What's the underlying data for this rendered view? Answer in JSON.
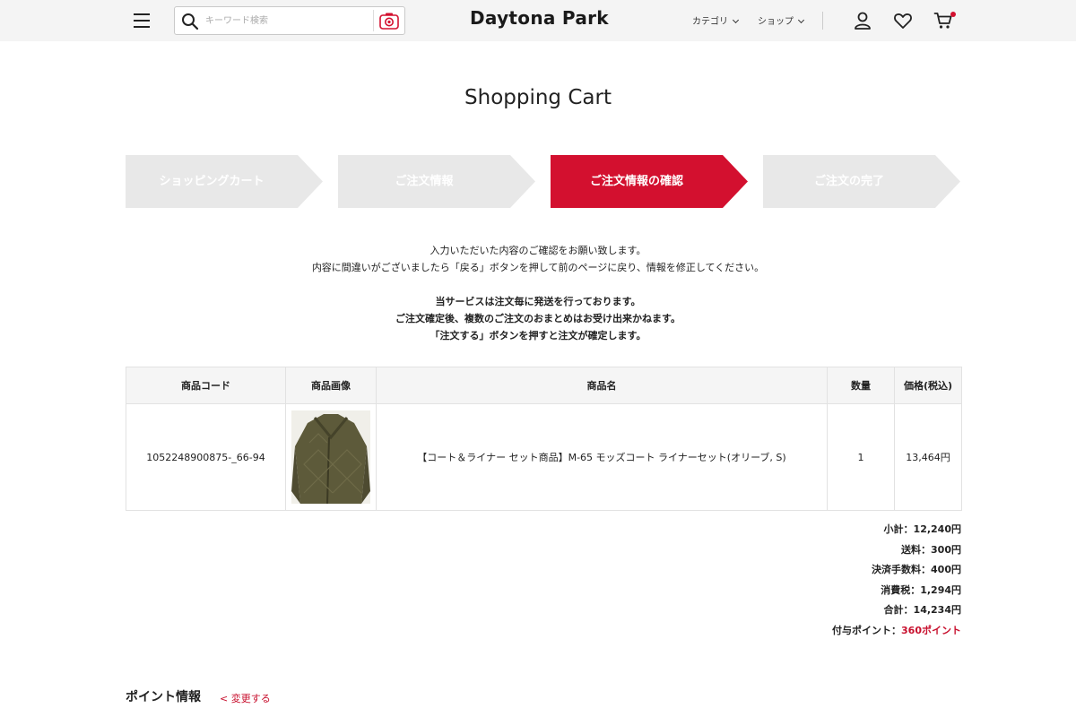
{
  "header": {
    "logo": "Daytona Park",
    "search": {
      "placeholder": "キーワード検索",
      "value": ""
    },
    "nav": [
      {
        "label": "カテゴリ"
      },
      {
        "label": "ショップ"
      }
    ]
  },
  "page": {
    "title": "Shopping Cart"
  },
  "steps": [
    {
      "label": "ショッピングカート",
      "active": false
    },
    {
      "label": "ご注文情報",
      "active": false
    },
    {
      "label": "ご注文情報の確認",
      "active": true
    },
    {
      "label": "ご注文の完了",
      "active": false
    }
  ],
  "notice": {
    "lines": [
      "入力いただいた内容のご確認をお願い致します。",
      "内容に間違いがございましたら「戻る」ボタンを押して前のページに戻り、情報を修正してください。"
    ],
    "bold_lines": [
      "当サービスは注文毎に発送を行っております。",
      "ご注文確定後、複数のご注文のおまとめはお受け出来かねます。",
      "「注文する」ボタンを押すと注文が確定します。"
    ]
  },
  "table": {
    "headers": [
      "商品コード",
      "商品画像",
      "商品名",
      "数量",
      "価格(税込)"
    ],
    "rows": [
      {
        "code": "1052248900875-_66-94",
        "name": "【コート＆ライナー セット商品】M-65 モッズコート ライナーセット(オリーブ, S)",
        "qty": "1",
        "price": "13,464円"
      }
    ]
  },
  "totals": {
    "subtotal": "小計：12,240円",
    "shipping": "送料：300円",
    "fee": "決済手数料：400円",
    "tax": "消費税：1,294円",
    "total": "合計：14,234円",
    "points_label": "付与ポイント：",
    "points_value": "360ポイント"
  },
  "points_section": {
    "title": "ポイント情報",
    "change_link": "< 変更する"
  },
  "colors": {
    "accent": "#d3102f",
    "step_inactive": "#e8e8e8",
    "header_bg": "#f4f4f4"
  }
}
